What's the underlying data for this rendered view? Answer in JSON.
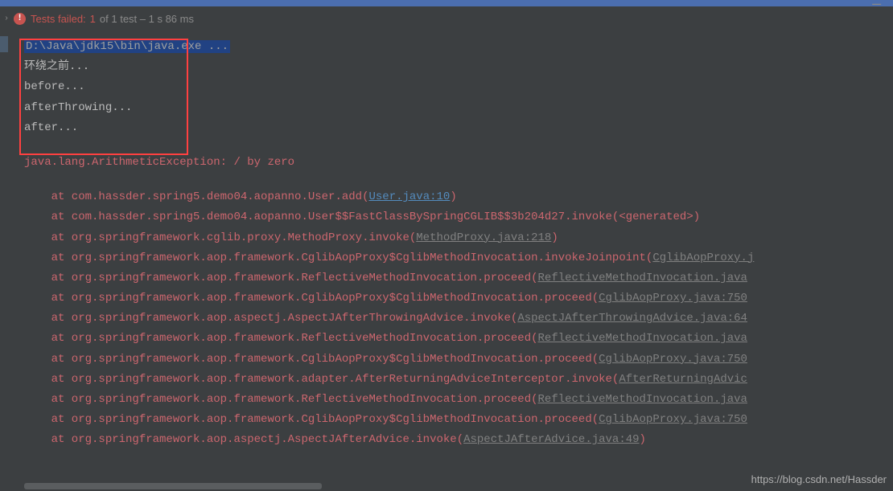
{
  "status": {
    "label": "Tests failed:",
    "count": "1",
    "of_text": "of 1 test – 1 s 86 ms"
  },
  "console": {
    "cmd": "D:\\Java\\jdk15\\bin\\java.exe ...",
    "lines": [
      "环绕之前...",
      "before...",
      "afterThrowing...",
      "after..."
    ],
    "exception": "java.lang.ArithmeticException: / by zero"
  },
  "stack": [
    {
      "prefix": "    at com.hassder.spring5.demo04.aopanno.User.add(",
      "link": "User.java:10",
      "linkClass": "stack-link",
      "suffix": ")"
    },
    {
      "prefix": "    at com.hassder.spring5.demo04.aopanno.User$$FastClassBySpringCGLIB$$3b204d27.invoke(<generated>)",
      "link": "",
      "linkClass": "",
      "suffix": ""
    },
    {
      "prefix": "    at org.springframework.cglib.proxy.MethodProxy.invoke(",
      "link": "MethodProxy.java:218",
      "linkClass": "stack-link-gray",
      "suffix": ")"
    },
    {
      "prefix": "    at org.springframework.aop.framework.CglibAopProxy$CglibMethodInvocation.invokeJoinpoint(",
      "link": "CglibAopProxy.j",
      "linkClass": "stack-link-gray",
      "suffix": ""
    },
    {
      "prefix": "    at org.springframework.aop.framework.ReflectiveMethodInvocation.proceed(",
      "link": "ReflectiveMethodInvocation.java",
      "linkClass": "stack-link-gray",
      "suffix": ""
    },
    {
      "prefix": "    at org.springframework.aop.framework.CglibAopProxy$CglibMethodInvocation.proceed(",
      "link": "CglibAopProxy.java:750",
      "linkClass": "stack-link-gray",
      "suffix": ""
    },
    {
      "prefix": "    at org.springframework.aop.aspectj.AspectJAfterThrowingAdvice.invoke(",
      "link": "AspectJAfterThrowingAdvice.java:64",
      "linkClass": "stack-link-gray",
      "suffix": ""
    },
    {
      "prefix": "    at org.springframework.aop.framework.ReflectiveMethodInvocation.proceed(",
      "link": "ReflectiveMethodInvocation.java",
      "linkClass": "stack-link-gray",
      "suffix": ""
    },
    {
      "prefix": "    at org.springframework.aop.framework.CglibAopProxy$CglibMethodInvocation.proceed(",
      "link": "CglibAopProxy.java:750",
      "linkClass": "stack-link-gray",
      "suffix": ""
    },
    {
      "prefix": "    at org.springframework.aop.framework.adapter.AfterReturningAdviceInterceptor.invoke(",
      "link": "AfterReturningAdvic",
      "linkClass": "stack-link-gray",
      "suffix": ""
    },
    {
      "prefix": "    at org.springframework.aop.framework.ReflectiveMethodInvocation.proceed(",
      "link": "ReflectiveMethodInvocation.java",
      "linkClass": "stack-link-gray",
      "suffix": ""
    },
    {
      "prefix": "    at org.springframework.aop.framework.CglibAopProxy$CglibMethodInvocation.proceed(",
      "link": "CglibAopProxy.java:750",
      "linkClass": "stack-link-gray",
      "suffix": ""
    },
    {
      "prefix": "    at org.springframework.aop.aspectj.AspectJAfterAdvice.invoke(",
      "link": "AspectJAfterAdvice.java:49",
      "linkClass": "stack-link-gray",
      "suffix": ")"
    }
  ],
  "watermark": "https://blog.csdn.net/Hassder"
}
